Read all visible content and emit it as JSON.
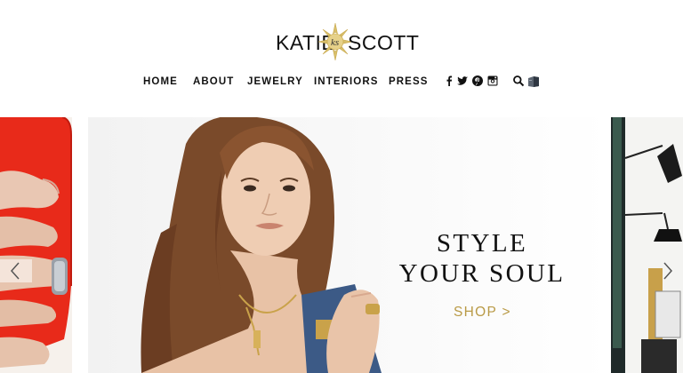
{
  "brand": {
    "logo_left": "KATIE",
    "logo_right": "SCOTT",
    "accent_color": "#b99a46"
  },
  "nav": {
    "items": [
      {
        "label": "HOME"
      },
      {
        "label": "ABOUT"
      },
      {
        "label": "JEWELRY"
      },
      {
        "label": "INTERIORS"
      },
      {
        "label": "PRESS"
      }
    ],
    "icons": [
      "facebook-icon",
      "twitter-icon",
      "pinterest-icon",
      "instagram-icon",
      "search-icon",
      "bag-icon"
    ]
  },
  "hero": {
    "headline_line1": "STYLE",
    "headline_line2": "YOUR SOUL",
    "cta_label": "SHOP >"
  },
  "slider": {
    "prev_icon": "chevron-left-icon",
    "next_icon": "chevron-right-icon"
  }
}
